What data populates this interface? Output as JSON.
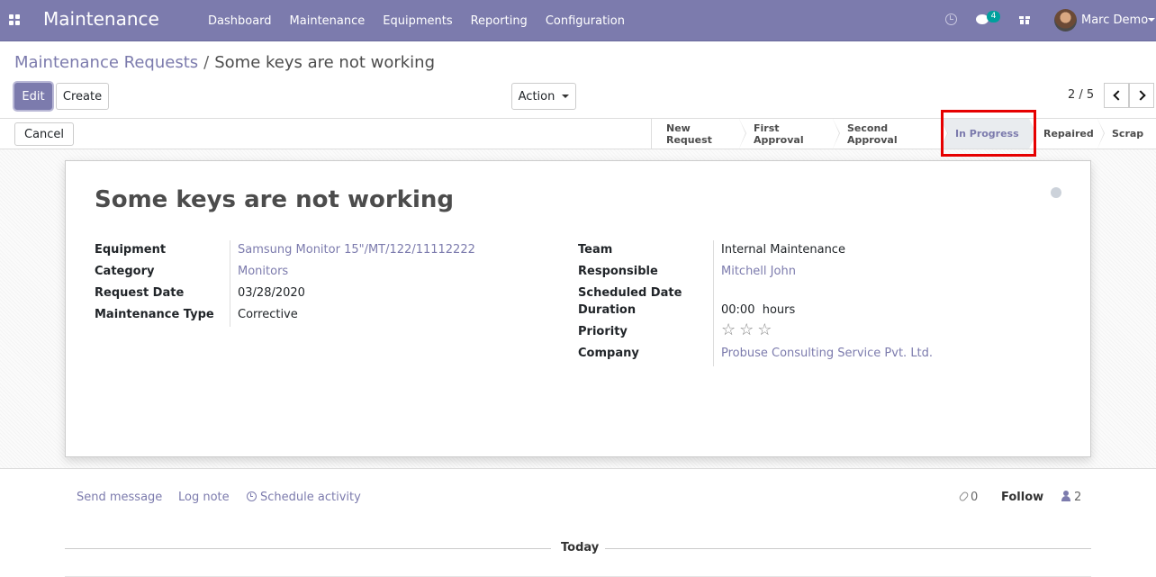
{
  "navbar": {
    "app_title": "Maintenance",
    "menu": [
      "Dashboard",
      "Maintenance",
      "Equipments",
      "Reporting",
      "Configuration"
    ],
    "message_count": "4",
    "user_name": "Marc Demo",
    "brand_color": "#7c7bad"
  },
  "breadcrumb": {
    "parent": "Maintenance Requests",
    "separator": "/",
    "current": "Some keys are not working"
  },
  "toolbar": {
    "edit_label": "Edit",
    "create_label": "Create",
    "action_label": "Action",
    "pager": "2 / 5"
  },
  "statusbar": {
    "cancel_label": "Cancel",
    "stages": [
      "New Request",
      "First Approval",
      "Second Approval",
      "In Progress",
      "Repaired",
      "Scrap"
    ],
    "active_stage": "In Progress"
  },
  "record": {
    "title": "Some keys are not working",
    "left_fields": [
      {
        "label": "Equipment",
        "value": "Samsung Monitor 15\"/MT/122/11112222"
      },
      {
        "label": "Category",
        "value": "Monitors"
      },
      {
        "label": "Request Date",
        "value": "03/28/2020"
      },
      {
        "label": "Maintenance Type",
        "value": "Corrective"
      }
    ],
    "right_fields": {
      "team": {
        "label": "Team",
        "value": "Internal Maintenance"
      },
      "responsible": {
        "label": "Responsible",
        "value": "Mitchell John"
      },
      "scheduled_date": {
        "label": "Scheduled Date",
        "value": ""
      },
      "duration": {
        "label": "Duration",
        "value": "00:00",
        "unit": "hours"
      },
      "priority": {
        "label": "Priority",
        "stars_total": 3,
        "stars_filled": 0
      },
      "company": {
        "label": "Company",
        "value": "Probuse Consulting Service Pvt. Ltd."
      }
    }
  },
  "chatter": {
    "send_message": "Send message",
    "log_note": "Log note",
    "schedule_activity": "Schedule activity",
    "attachments_count": "0",
    "follow_label": "Follow",
    "followers_count": "2",
    "today_label": "Today"
  }
}
